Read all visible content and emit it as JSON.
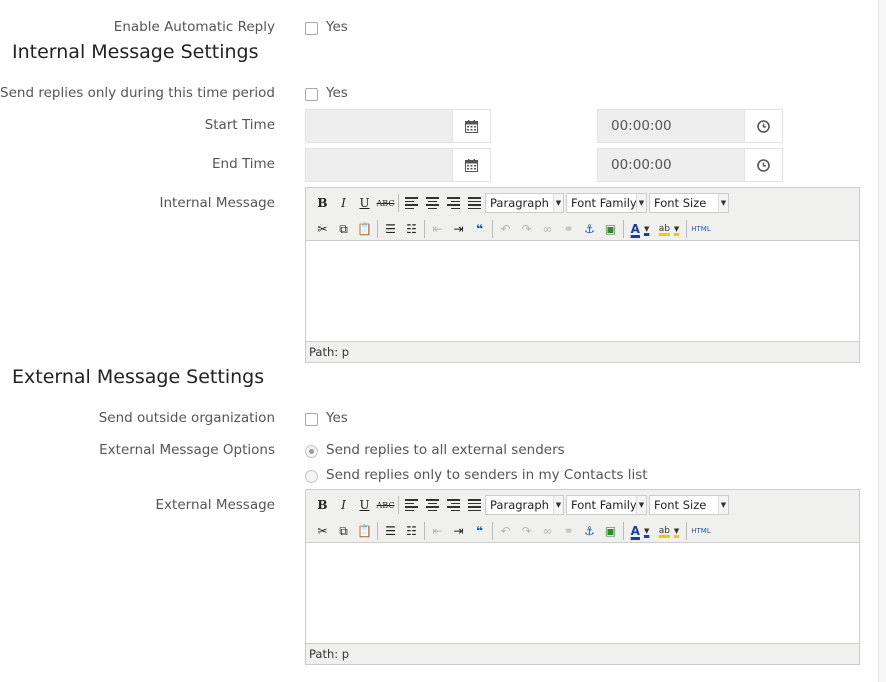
{
  "auto_reply": {
    "label": "Enable Automatic Reply",
    "checkbox_label": "Yes"
  },
  "internal": {
    "section_title": "Internal Message Settings",
    "time_period": {
      "label": "Send replies only during this time period",
      "checkbox_label": "Yes"
    },
    "start_time": {
      "label": "Start Time",
      "date_value": "",
      "time_value": "00:00:00"
    },
    "end_time": {
      "label": "End Time",
      "date_value": "",
      "time_value": "00:00:00"
    },
    "message": {
      "label": "Internal Message",
      "path": "Path: p"
    }
  },
  "external": {
    "section_title": "External Message Settings",
    "outside_org": {
      "label": "Send outside organization",
      "checkbox_label": "Yes"
    },
    "options": {
      "label": "External Message Options",
      "choices": [
        "Send replies to all external senders",
        "Send replies only to senders in my Contacts list"
      ],
      "selected": 0
    },
    "message": {
      "label": "External Message",
      "path": "Path: p"
    }
  },
  "editor": {
    "format_select": "Paragraph",
    "font_family_select": "Font Family",
    "font_size_select": "Font Size",
    "bold": "B",
    "italic": "I",
    "underline": "U",
    "strike": "ABC",
    "html": "HTML",
    "text_color": "A",
    "highlight": "ab",
    "icons": {
      "row1": [
        "bold-icon",
        "italic-icon",
        "underline-icon",
        "strikethrough-icon",
        "align-left-icon",
        "align-center-icon",
        "align-right-icon",
        "justify-icon"
      ],
      "row2": [
        "cut-icon",
        "copy-icon",
        "paste-icon",
        "bullet-list-icon",
        "numbered-list-icon",
        "outdent-icon",
        "indent-icon",
        "blockquote-icon",
        "undo-icon",
        "redo-icon",
        "link-icon",
        "unlink-icon",
        "anchor-icon",
        "image-icon",
        "text-color-icon",
        "highlight-icon",
        "html-source-icon"
      ]
    }
  },
  "colors": {
    "field_bg": "#eeeeee",
    "toolbar_bg": "#f0f0ee",
    "border": "#cccccc",
    "title": "#222222",
    "label": "#555555"
  }
}
